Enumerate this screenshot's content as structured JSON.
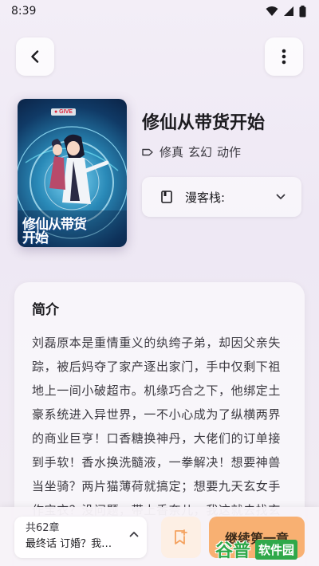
{
  "status_bar": {
    "time": "8:39"
  },
  "book": {
    "title": "修仙从带货开始",
    "tags": [
      "修真",
      "玄幻",
      "动作"
    ],
    "cover": {
      "logo_text": "● GIVE",
      "title_text": "修仙从带货开始"
    }
  },
  "source": {
    "label": "漫客栈:"
  },
  "intro": {
    "heading": "简介",
    "text": "刘磊原本是重情重义的纨绔子弟，却因父亲失踪，被后妈夺了家产逐出家门，手中仅剩下祖地上一间小破超市。机缘巧合之下，他绑定土豪系统进入异世界，一不小心成为了纵横两界的商业巨亨！口香糖换神丹，大佬们的订单接到手软！香水换洗髓液，一拳解决！想要神兽当坐骑？两片猫薄荷就搞定；想要九天玄女手作宝衣？没问题，带上香奈儿，我这就去找玄"
  },
  "bottom": {
    "chapter_count": "共62章",
    "latest_chapter": "最终话 订婚？我…",
    "read_button": "继续第一章"
  },
  "watermark": {
    "brand": "谷普",
    "text": "软件园"
  },
  "icons": {
    "back": "back-arrow-icon",
    "more": "more-vertical-icon",
    "tag": "tag-icon",
    "source": "book-icon",
    "dropdown": "chevron-down-icon",
    "chapter_expand": "chevron-up-icon",
    "bookmark": "bookmark-add-icon"
  },
  "colors": {
    "accent": "#f8b072",
    "background": "#f1ecf5",
    "watermark_green": "#2fa84a"
  }
}
